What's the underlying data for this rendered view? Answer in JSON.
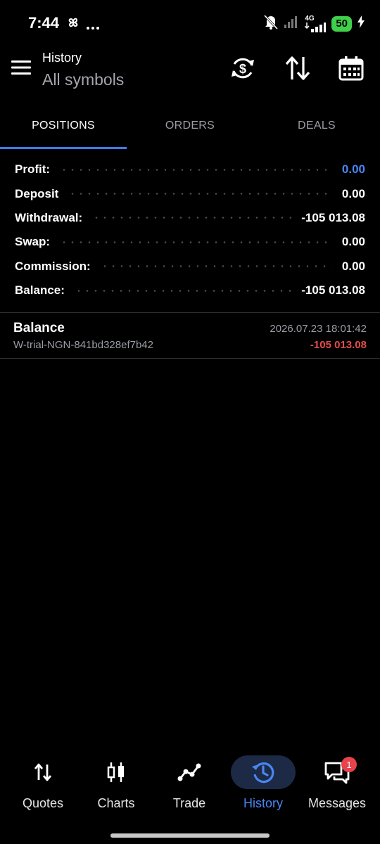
{
  "status_bar": {
    "time": "7:44",
    "left_icons": [
      "pinwheel-icon",
      "more-dots-icon"
    ],
    "right_icons": [
      "bell-muted-icon",
      "signal-icon",
      "lte-signal-icon",
      "charging-icon"
    ],
    "network": "4G",
    "battery": "50"
  },
  "app_bar": {
    "title": "History",
    "subtitle": "All symbols",
    "actions": [
      "currency-refresh-icon",
      "sort-icon",
      "calendar-icon"
    ]
  },
  "tabs": [
    {
      "label": "POSITIONS",
      "active": true
    },
    {
      "label": "ORDERS",
      "active": false
    },
    {
      "label": "DEALS",
      "active": false
    }
  ],
  "summary": [
    {
      "label": "Profit:",
      "value": "0.00"
    },
    {
      "label": "Deposit",
      "value": "0.00"
    },
    {
      "label": "Withdrawal:",
      "value": "-105 013.08"
    },
    {
      "label": "Swap:",
      "value": "0.00"
    },
    {
      "label": "Commission:",
      "value": "0.00"
    },
    {
      "label": "Balance:",
      "value": "-105 013.08"
    }
  ],
  "deals": [
    {
      "name": "Balance",
      "id": "W-trial-NGN-841bd328ef7b42",
      "time": "2026.07.23 18:01:42",
      "amount": "-105 013.08"
    }
  ],
  "bottom_nav": [
    {
      "label": "Quotes",
      "icon": "quotes-arrows-icon",
      "active": false
    },
    {
      "label": "Charts",
      "icon": "candlestick-icon",
      "active": false
    },
    {
      "label": "Trade",
      "icon": "trend-line-icon",
      "active": false
    },
    {
      "label": "History",
      "icon": "history-clock-icon",
      "active": true
    },
    {
      "label": "Messages",
      "icon": "chat-bubbles-icon",
      "active": false,
      "badge": "1"
    }
  ],
  "colors": {
    "accent": "#3d7bef",
    "profit_blue": "#4a86f3",
    "negative_red": "#e84b4b",
    "battery_green": "#3fcf4a",
    "badge_red": "#e8434a"
  }
}
